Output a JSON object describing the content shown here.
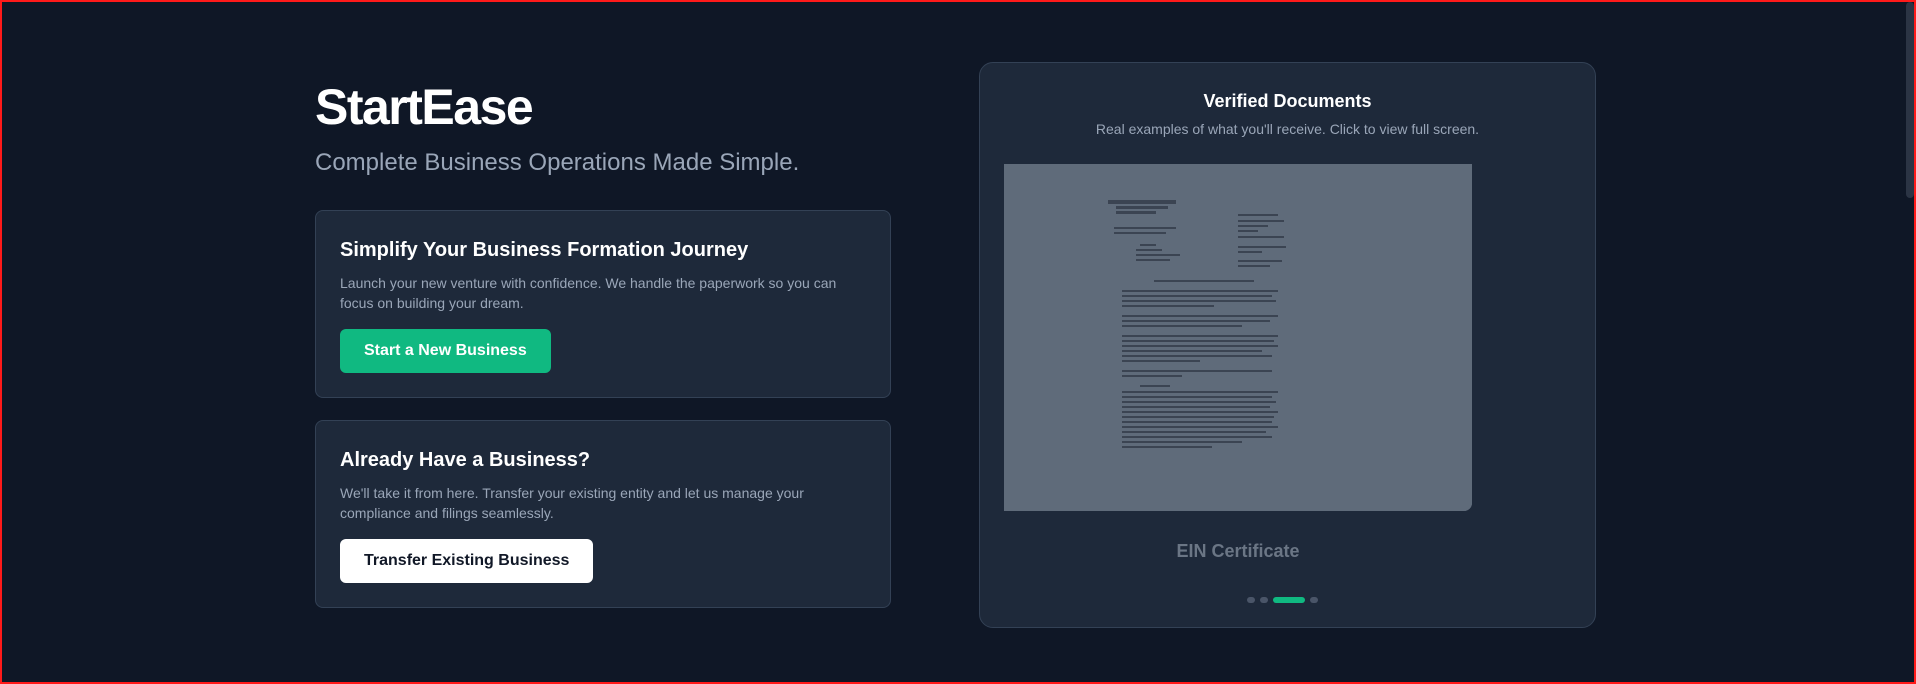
{
  "hero": {
    "title": "StartEase",
    "tagline": "Complete Business Operations Made Simple."
  },
  "new_business": {
    "heading": "Simplify Your Business Formation Journey",
    "description": "Launch your new venture with confidence. We handle the paperwork so you can focus on building your dream.",
    "button_label": "Start a New Business"
  },
  "existing_business": {
    "heading": "Already Have a Business?",
    "description": "We'll take it from here. Transfer your existing entity and let us manage your compliance and filings seamlessly.",
    "button_label": "Transfer Existing Business"
  },
  "documents": {
    "title": "Verified Documents",
    "subtitle": "Real examples of what you'll receive. Click to view full screen.",
    "current_caption": "EIN Certificate",
    "slide_count": 4,
    "active_slide": 3
  },
  "colors": {
    "background": "#0f1726",
    "card": "#1e293a",
    "accent": "#10b981",
    "muted_text": "#9aa6b8"
  }
}
